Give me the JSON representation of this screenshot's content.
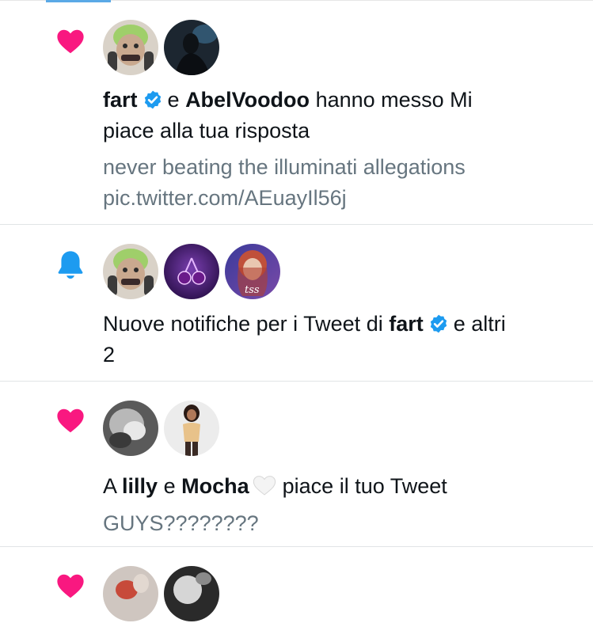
{
  "notifications": [
    {
      "type_icon": "heart-icon",
      "avatars": [
        "avatar-green-face",
        "avatar-dark-figure"
      ],
      "user1": "fart",
      "connector": "e",
      "user2": "AbelVoodoo",
      "action_line1": "hanno messo Mi",
      "action_line2": "piace alla tua risposta",
      "quote_line1": "never beating the illuminati allegations",
      "quote_line2": "pic.twitter.com/AEuayIl56j"
    },
    {
      "type_icon": "bell-icon",
      "avatars": [
        "avatar-green-face",
        "avatar-cherries",
        "avatar-tss"
      ],
      "avatar_tss_label": "tss",
      "text_prefix": "Nuove notifiche per i Tweet di",
      "user": "fart",
      "text_suffix": "e altri",
      "text_line2": "2"
    },
    {
      "type_icon": "heart-icon",
      "avatars": [
        "avatar-blurry-photo",
        "avatar-woman"
      ],
      "prefix": "A",
      "user1": "lilly",
      "connector": "e",
      "user2": "Mocha",
      "action": "piace il tuo Tweet",
      "quote": "GUYS????????"
    },
    {
      "type_icon": "heart-icon",
      "avatars": [
        "avatar-partial-1",
        "avatar-partial-2"
      ]
    }
  ],
  "colors": {
    "heart": "#f91880",
    "bell": "#1d9bf0",
    "verified": "#1d9bf0",
    "secondary_text": "#66757f",
    "divider": "#e1e4e6"
  }
}
